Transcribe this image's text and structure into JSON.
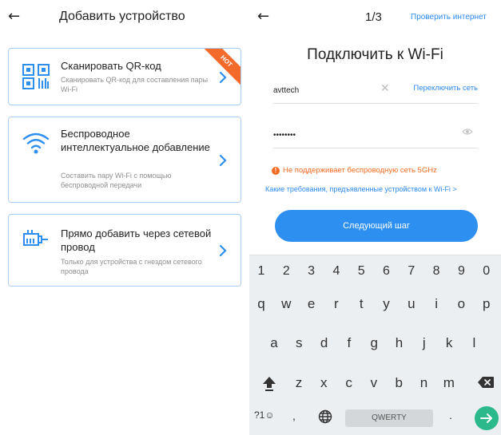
{
  "left": {
    "back_glyph": "←",
    "title": "Добавить устройство",
    "cards": [
      {
        "title": "Сканировать QR-код",
        "subtitle": "Сканировать QR-код для составления пары Wi-Fi",
        "badge": "HOT",
        "icon": "qr-scan-icon"
      },
      {
        "title": "Беспроводное интеллектуальное добавление",
        "subtitle": "Составить пару Wi-Fi с помощью беспроводной передачи",
        "icon": "wifi-icon"
      },
      {
        "title": "Прямо добавить через сетевой провод",
        "subtitle": "Только для устройства с гнездом сетевого провода",
        "icon": "ethernet-plug-icon"
      }
    ]
  },
  "right": {
    "back_glyph": "←",
    "step": "1/3",
    "check_internet": "Проверить интернет",
    "heading": "Подключить к Wi-Fi",
    "ssid_value": "avttech",
    "clear_glyph": "✕",
    "switch_network": "Переключить сеть",
    "password_value": "••••••••",
    "warning_icon_glyph": "!",
    "warning": "Не поддерживает беспроводную сеть 5GHz",
    "requirements_link": "Какие требования, предъявленные устройством к Wi-Fi >",
    "next_button": "Следующий шаг"
  },
  "keyboard": {
    "numbers": [
      "1",
      "2",
      "3",
      "4",
      "5",
      "6",
      "7",
      "8",
      "9",
      "0"
    ],
    "row1": [
      "q",
      "w",
      "e",
      "r",
      "t",
      "y",
      "u",
      "i",
      "o",
      "p"
    ],
    "row2": [
      "a",
      "s",
      "d",
      "f",
      "g",
      "h",
      "j",
      "k",
      "l"
    ],
    "row3": [
      "z",
      "x",
      "c",
      "v",
      "b",
      "n",
      "m"
    ],
    "symbols_key": "?1☺",
    "comma_key": ",",
    "space_label": "QWERTY",
    "period_key": "."
  },
  "colors": {
    "accent": "#2d8ff0",
    "card_border": "#a9cdf0",
    "warning": "#f26b21",
    "hot_badge": "#f46a2b",
    "enter_key": "#2bb88a"
  }
}
